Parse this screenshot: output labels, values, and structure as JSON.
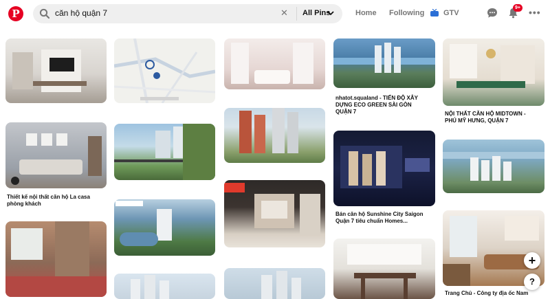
{
  "header": {
    "logo": "P",
    "search_value": "căn hộ quận 7",
    "clear_symbol": "✕",
    "filter_label": "All Pins",
    "nav": {
      "home": "Home",
      "following": "Following",
      "gtv": "GTV"
    },
    "notification_count": "9+",
    "more_symbol": "•••"
  },
  "pins": [
    {
      "caption": ""
    },
    {
      "caption": ""
    },
    {
      "caption": ""
    },
    {
      "caption_lines": [
        "nhatot.squaland - TIẾN ĐỘ XÂY",
        "DỰNG ECO GREEN SÀI GÒN",
        "QUẬN 7"
      ]
    },
    {
      "caption_lines": [
        "NỘI THẤT CĂN HỘ MIDTOWN -",
        "PHÚ MỸ HƯNG, QUẬN 7"
      ]
    },
    {
      "caption_lines": [
        "Thiết kế nội thất căn hộ La casa",
        "phòng khách"
      ]
    },
    {
      "caption": ""
    },
    {
      "caption": ""
    },
    {
      "caption_lines": [
        "Bán căn hộ Sunshine City Saigon",
        "Quận 7 tiêu chuẩn Homes..."
      ]
    },
    {
      "caption": ""
    },
    {
      "caption_lines": [
        "Trang Chủ - Công ty địa ốc Nam"
      ]
    }
  ],
  "fab": {
    "add": "+",
    "help": "?"
  },
  "colors": {
    "brand": "#e60023",
    "search_bg": "#efefef",
    "nav_text": "#767676"
  }
}
